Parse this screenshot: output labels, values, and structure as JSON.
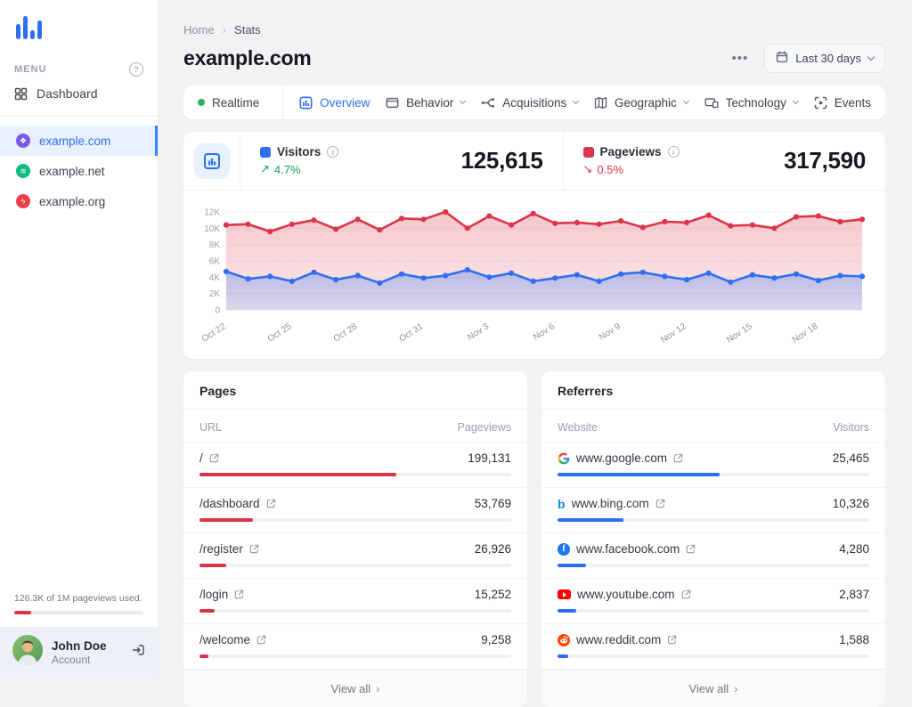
{
  "colors": {
    "accent_blue": "#2e6ff2",
    "accent_red": "#dc3448",
    "green": "#2eb356"
  },
  "sidebar": {
    "menu_label": "MENU",
    "dashboard_label": "Dashboard",
    "sites": [
      {
        "name": "example.com",
        "icon": "clover-favicon",
        "color": "#7b5be6",
        "active": true
      },
      {
        "name": "example.net",
        "icon": "waves-favicon",
        "color": "#10b981",
        "active": false
      },
      {
        "name": "example.org",
        "icon": "bolt-favicon",
        "color": "#ec4149",
        "active": false
      }
    ],
    "usage_text": "126.3K of 1M pageviews used.",
    "usage_pct": 13,
    "user": {
      "name": "John Doe",
      "role": "Account"
    }
  },
  "header": {
    "breadcrumb": [
      "Home",
      "Stats"
    ],
    "title": "example.com",
    "more_label": "•••",
    "date_range": "Last 30 days"
  },
  "tabs": [
    {
      "label": "Realtime",
      "icon": "realtime-dot",
      "active": false,
      "chevron": false,
      "segment": true
    },
    {
      "label": "Overview",
      "icon": "overview-icon",
      "active": true,
      "chevron": false,
      "segment": false
    },
    {
      "label": "Behavior",
      "icon": "window-icon",
      "active": false,
      "chevron": true,
      "segment": false
    },
    {
      "label": "Acquisitions",
      "icon": "split-icon",
      "active": false,
      "chevron": true,
      "segment": false
    },
    {
      "label": "Geographic",
      "icon": "map-icon",
      "active": false,
      "chevron": true,
      "segment": false
    },
    {
      "label": "Technology",
      "icon": "devices-icon",
      "active": false,
      "chevron": true,
      "segment": false
    },
    {
      "label": "Events",
      "icon": "scan-icon",
      "active": false,
      "chevron": false,
      "segment": false
    }
  ],
  "stats": [
    {
      "label": "Visitors",
      "value": "125,615",
      "delta": "4.7%",
      "direction": "up",
      "color": "#2e6ff2"
    },
    {
      "label": "Pageviews",
      "value": "317,590",
      "delta": "0.5%",
      "direction": "down",
      "color": "#dc3448"
    }
  ],
  "chart_data": {
    "type": "line",
    "x": [
      "Oct 22",
      "Oct 23",
      "Oct 24",
      "Oct 25",
      "Oct 26",
      "Oct 27",
      "Oct 28",
      "Oct 29",
      "Oct 30",
      "Oct 31",
      "Nov 1",
      "Nov 2",
      "Nov 3",
      "Nov 4",
      "Nov 5",
      "Nov 6",
      "Nov 7",
      "Nov 8",
      "Nov 9",
      "Nov 10",
      "Nov 11",
      "Nov 12",
      "Nov 13",
      "Nov 14",
      "Nov 15",
      "Nov 16",
      "Nov 17",
      "Nov 18",
      "Nov 19",
      "Nov 20"
    ],
    "x_label_every": 3,
    "series": [
      {
        "name": "Pageviews",
        "color": "#dc3448",
        "values": [
          10400,
          10500,
          9600,
          10500,
          11000,
          9900,
          11100,
          9800,
          11200,
          11100,
          12000,
          10000,
          11500,
          10400,
          11800,
          10600,
          10700,
          10500,
          10900,
          10100,
          10800,
          10700,
          11600,
          10300,
          10400,
          10000,
          11400,
          11500,
          10800,
          11100
        ]
      },
      {
        "name": "Visitors",
        "color": "#2e6ff2",
        "values": [
          4700,
          3800,
          4100,
          3500,
          4600,
          3700,
          4200,
          3300,
          4400,
          3900,
          4200,
          4900,
          4000,
          4500,
          3500,
          3900,
          4300,
          3500,
          4400,
          4600,
          4100,
          3700,
          4500,
          3400,
          4300,
          3900,
          4400,
          3600,
          4200,
          4100
        ]
      }
    ],
    "ylim": [
      0,
      12000
    ],
    "yticks": [
      {
        "value": 0,
        "label": "0"
      },
      {
        "value": 2000,
        "label": "2K"
      },
      {
        "value": 4000,
        "label": "4K"
      },
      {
        "value": 6000,
        "label": "6K"
      },
      {
        "value": 8000,
        "label": "8K"
      },
      {
        "value": 10000,
        "label": "10K"
      },
      {
        "value": 12000,
        "label": "12K"
      }
    ],
    "grid": "horizontal",
    "legend_position": "in-stats-row"
  },
  "pages": {
    "title": "Pages",
    "col_left": "URL",
    "col_right": "Pageviews",
    "view_all": "View all",
    "bar_color": "#dc3448",
    "rows": [
      {
        "label": "/",
        "value": "199,131",
        "bar_pct": 63
      },
      {
        "label": "/dashboard",
        "value": "53,769",
        "bar_pct": 17
      },
      {
        "label": "/register",
        "value": "26,926",
        "bar_pct": 8.5
      },
      {
        "label": "/login",
        "value": "15,252",
        "bar_pct": 4.8
      },
      {
        "label": "/welcome",
        "value": "9,258",
        "bar_pct": 2.9
      }
    ]
  },
  "referrers": {
    "title": "Referrers",
    "col_left": "Website",
    "col_right": "Visitors",
    "view_all": "View all",
    "bar_color": "#2e6ff2",
    "rows": [
      {
        "label": "www.google.com",
        "icon": "google-favicon",
        "value": "25,465",
        "bar_pct": 52
      },
      {
        "label": "www.bing.com",
        "icon": "bing-favicon",
        "value": "10,326",
        "bar_pct": 21
      },
      {
        "label": "www.facebook.com",
        "icon": "facebook-favicon",
        "value": "4,280",
        "bar_pct": 9
      },
      {
        "label": "www.youtube.com",
        "icon": "youtube-favicon",
        "value": "2,837",
        "bar_pct": 6
      },
      {
        "label": "www.reddit.com",
        "icon": "reddit-favicon",
        "value": "1,588",
        "bar_pct": 3.5
      }
    ]
  }
}
